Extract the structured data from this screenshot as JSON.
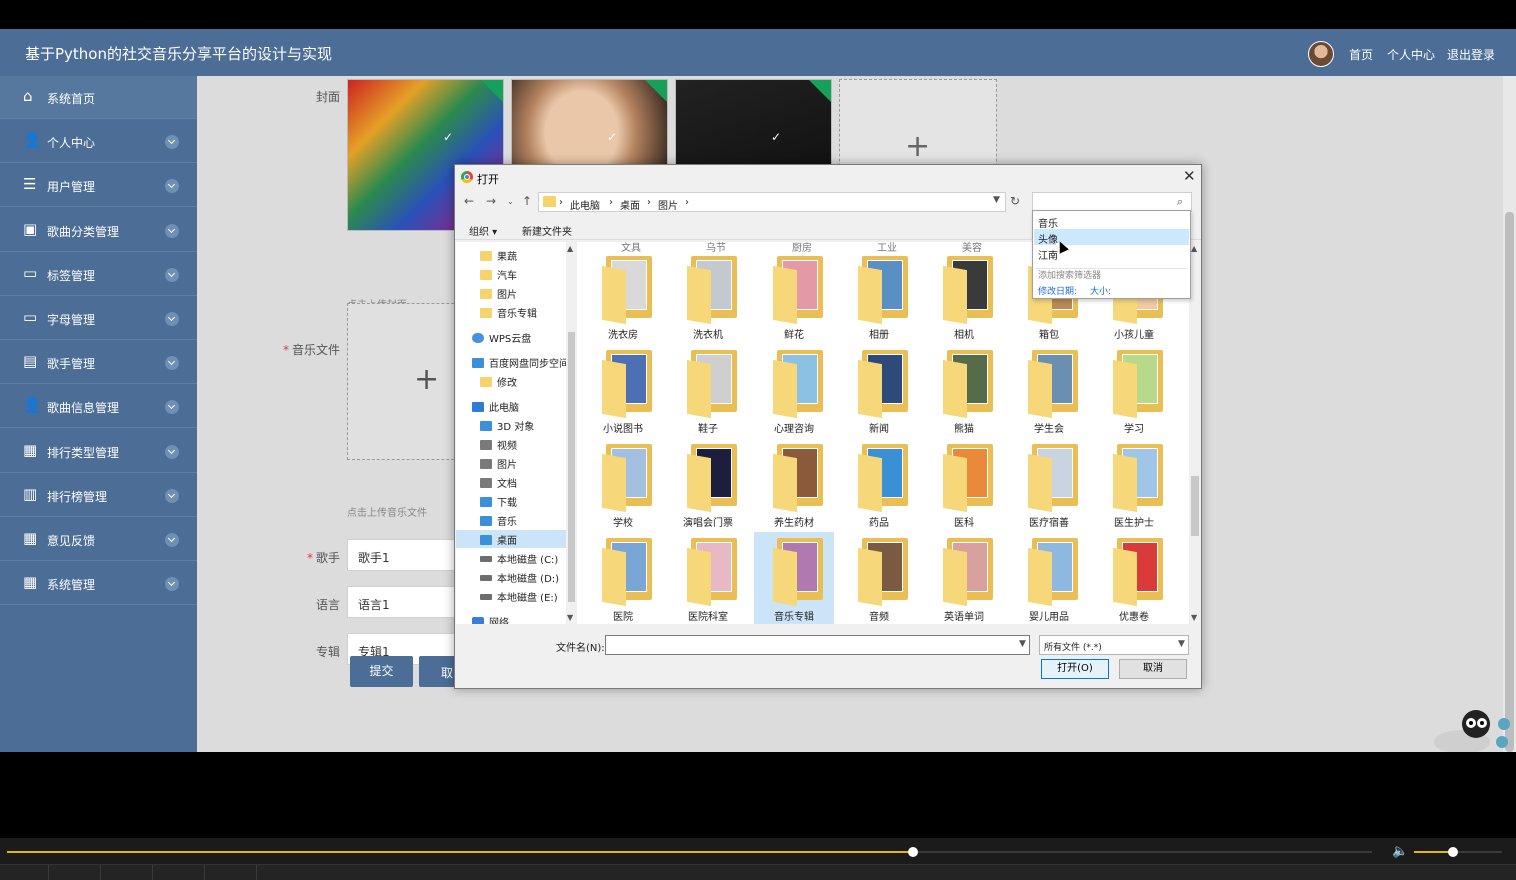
{
  "app": {
    "title": "基于Python的社交音乐分享平台的设计与实现",
    "top_links": [
      "首页",
      "个人中心",
      "退出登录"
    ]
  },
  "sidebar": {
    "items": [
      {
        "label": "系统首页",
        "icon": "home-icon"
      },
      {
        "label": "个人中心",
        "icon": "user-icon"
      },
      {
        "label": "用户管理",
        "icon": "list-icon"
      },
      {
        "label": "歌曲分类管理",
        "icon": "briefcase-icon"
      },
      {
        "label": "标签管理",
        "icon": "monitor-icon"
      },
      {
        "label": "字母管理",
        "icon": "monitor-icon"
      },
      {
        "label": "歌手管理",
        "icon": "wallet-icon"
      },
      {
        "label": "歌曲信息管理",
        "icon": "user-icon"
      },
      {
        "label": "排行类型管理",
        "icon": "grid-icon"
      },
      {
        "label": "排行榜管理",
        "icon": "clipboard-icon"
      },
      {
        "label": "意见反馈",
        "icon": "grid-icon"
      },
      {
        "label": "系统管理",
        "icon": "grid-icon"
      }
    ]
  },
  "form": {
    "cover_label": "封面",
    "cover_hint": "点击上传封面",
    "music_label": "音乐文件",
    "music_hint": "点击上传音乐文件",
    "singer_label": "歌手",
    "singer_value": "歌手1",
    "language_label": "语言",
    "language_value": "语言1",
    "album_label": "专辑",
    "album_value": "专辑1",
    "submit_label": "提交",
    "cancel_label": "取"
  },
  "dialog": {
    "title": "打开",
    "breadcrumbs": [
      "此电脑",
      "桌面",
      "图片"
    ],
    "toolbar": {
      "organize": "组织 ▾",
      "new_folder": "新建文件夹"
    },
    "tree": [
      {
        "label": "果蔬",
        "icon": "folder"
      },
      {
        "label": "汽车",
        "icon": "folder"
      },
      {
        "label": "图片",
        "icon": "folder"
      },
      {
        "label": "音乐专辑",
        "icon": "folder"
      },
      {
        "label": "WPS云盘",
        "icon": "cloud"
      },
      {
        "label": "百度网盘同步空间",
        "icon": "blue"
      },
      {
        "label": "修改",
        "icon": "folder"
      },
      {
        "label": "此电脑",
        "icon": "pc"
      },
      {
        "label": "3D 对象",
        "icon": "blue"
      },
      {
        "label": "视频",
        "icon": "gray"
      },
      {
        "label": "图片",
        "icon": "gray"
      },
      {
        "label": "文档",
        "icon": "gray"
      },
      {
        "label": "下载",
        "icon": "blue"
      },
      {
        "label": "音乐",
        "icon": "blue"
      },
      {
        "label": "桌面",
        "icon": "blue"
      },
      {
        "label": "本地磁盘 (C:)",
        "icon": "disk"
      },
      {
        "label": "本地磁盘 (D:)",
        "icon": "disk"
      },
      {
        "label": "本地磁盘 (E:)",
        "icon": "disk"
      },
      {
        "label": "网络",
        "icon": "net"
      }
    ],
    "partial_labels": [
      "文具",
      "乌节",
      "厨房",
      "工业",
      "美容"
    ],
    "files": [
      {
        "label": "洗衣房",
        "color": "#d9d9d9"
      },
      {
        "label": "洗衣机",
        "color": "#c4c9cf"
      },
      {
        "label": "鲜花",
        "color": "#e39aa6"
      },
      {
        "label": "相册",
        "color": "#5a8fc4"
      },
      {
        "label": "相机",
        "color": "#3a3a3a"
      },
      {
        "label": "箱包",
        "color": "#b98a52"
      },
      {
        "label": "小孩儿童",
        "color": "#f2c9a0"
      },
      {
        "label": "小说图书",
        "color": "#4d6fb3"
      },
      {
        "label": "鞋子",
        "color": "#cfcfcf"
      },
      {
        "label": "心理咨询",
        "color": "#8bc2e3"
      },
      {
        "label": "新闻",
        "color": "#2e4a7a"
      },
      {
        "label": "熊猫",
        "color": "#556b4a"
      },
      {
        "label": "学生会",
        "color": "#6b8fb0"
      },
      {
        "label": "学习",
        "color": "#b8d98a"
      },
      {
        "label": "学校",
        "color": "#a3c0e0"
      },
      {
        "label": "演唱会门票",
        "color": "#1d1d3d"
      },
      {
        "label": "养生药材",
        "color": "#8a5a3a"
      },
      {
        "label": "药品",
        "color": "#3b8fd4"
      },
      {
        "label": "医科",
        "color": "#e88a3a"
      },
      {
        "label": "医疗宿善",
        "color": "#c9d4e0"
      },
      {
        "label": "医生护士",
        "color": "#9fc6e6"
      },
      {
        "label": "医院",
        "color": "#7aa6d6"
      },
      {
        "label": "医院科室",
        "color": "#e6b9c4"
      },
      {
        "label": "音乐专辑",
        "color": "#b07ab0"
      },
      {
        "label": "音频",
        "color": "#7a5a40"
      },
      {
        "label": "英语单词",
        "color": "#d9a0a0"
      },
      {
        "label": "婴儿用品",
        "color": "#8fb8e0"
      },
      {
        "label": "优惠卷",
        "color": "#d93a3a"
      }
    ],
    "filename_label": "文件名(N):",
    "filter_value": "所有文件 (*.*)",
    "open_label": "打开(O)",
    "cancel_label": "取消",
    "search_dropdown": {
      "items": [
        "音乐",
        "头像",
        "江南"
      ],
      "hint": "添加搜索筛选器",
      "filters": [
        "修改日期:",
        "大小:"
      ]
    }
  },
  "player": {
    "progress": 0.664,
    "volume": 0.44
  },
  "colors": {
    "brand": "#4b6d96",
    "accent": "#e6b800"
  }
}
